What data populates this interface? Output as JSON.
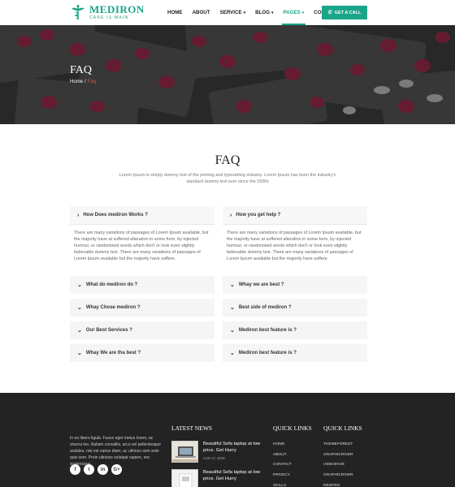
{
  "brand": {
    "name": "MEDIRON",
    "tagline": "CARE IS MAIN",
    "color": "#1aa58a"
  },
  "nav": [
    {
      "label": "HOME",
      "dropdown": false,
      "active": false
    },
    {
      "label": "ABOUT",
      "dropdown": false,
      "active": false
    },
    {
      "label": "SERVICE",
      "dropdown": true,
      "active": false
    },
    {
      "label": "BLOG",
      "dropdown": true,
      "active": false
    },
    {
      "label": "PAGES",
      "dropdown": true,
      "active": true
    },
    {
      "label": "CONTACT",
      "dropdown": false,
      "active": false
    }
  ],
  "call_button": "GET A CALL",
  "hero": {
    "title": "FAQ",
    "breadcrumb_home": "Home",
    "breadcrumb_sep": "/",
    "breadcrumb_current": "Faq"
  },
  "faq": {
    "title": "FAQ",
    "subtitle": "Lorem Ipsum is simply dummy text of the printing and typesetting industry. Lorem Ipsum has been the industry's standard dummy text ever since the 1500s",
    "left": [
      {
        "q": "How Does mediron Works ?",
        "open": true,
        "a": "There are many variations of passages of Lorem Ipsum available, but the majority have at suffered alteration in some form, by injected humour, or randomised words which don't or look even slightly believable dummy text. There are many variations of passages of Lorem Ipsum available but the majority have suffere."
      },
      {
        "q": "What do mediron do ?",
        "open": false
      },
      {
        "q": "Whay Chose mediron ?",
        "open": false
      },
      {
        "q": "Our Best Services ?",
        "open": false
      },
      {
        "q": "Whay We are tha best ?",
        "open": false
      }
    ],
    "right": [
      {
        "q": "How you get help ?",
        "open": true,
        "a": "There are many variations of passages of Lorem Ipsum available, but the majority have at suffered alteration in some form, by injected humour, or randomised words which don't or look even slightly believable dummy text. There are many variations of passages of Lorem Ipsum available but the majority have suffere."
      },
      {
        "q": "Whay we are best ?",
        "open": false
      },
      {
        "q": "Best side of mediron ?",
        "open": false
      },
      {
        "q": "Mediron best feature is ?",
        "open": false
      },
      {
        "q": "Mediron best feature is ?",
        "open": false
      }
    ]
  },
  "footer": {
    "about": "In eu libero ligula. Fusce eget metus lorem, ac viverra leo. Nullam convallis, arcu vel pellentesque sodales, nisi est varius diam, ac ultrices sem ante quis sem. Proin ultricies volutpat sapien, nec scelerisque.",
    "social": [
      {
        "icon": "facebook-icon",
        "glyph": "f"
      },
      {
        "icon": "twitter-icon",
        "glyph": "t"
      },
      {
        "icon": "linkedin-icon",
        "glyph": "in"
      },
      {
        "icon": "google-plus-icon",
        "glyph": "G+"
      }
    ],
    "news_heading": "LATEST NEWS",
    "news": [
      {
        "title": "Beautiful Sofa laptop at low price. Get Hurry",
        "date": "AUG 17, 2018"
      },
      {
        "title": "Beautiful Sofa laptop at low price. Get Hurry",
        "date": ""
      }
    ],
    "links1_heading": "QUICK LINKS",
    "links1": [
      "HOME",
      "ABOUT",
      "CONTACT",
      "PRIVECY",
      "SKILLS"
    ],
    "links2_heading": "QUICK LINKS",
    "links2": [
      "THEMEFOREST",
      "GRAPHICRIVER",
      "VIDEOHIVE",
      "GRAPHICRIVER",
      "REDPEN"
    ]
  }
}
